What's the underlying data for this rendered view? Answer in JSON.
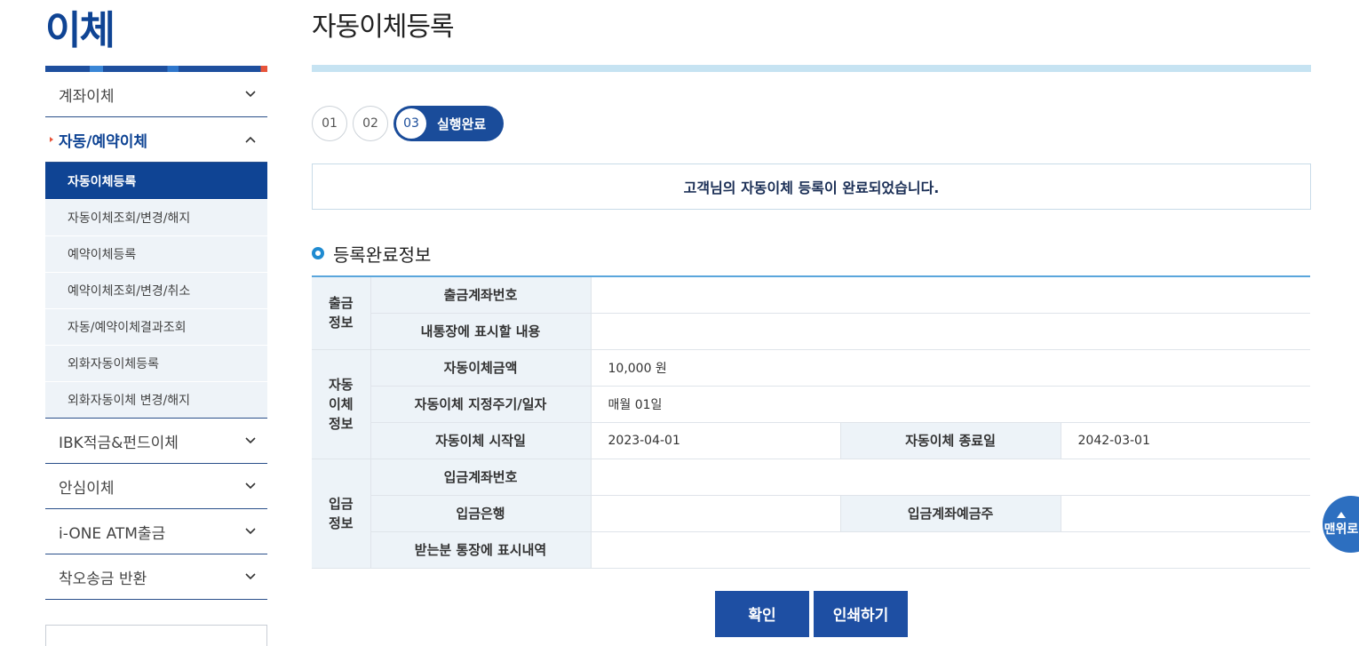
{
  "sidebar": {
    "section_title": "이체",
    "menu": [
      {
        "label": "계좌이체"
      },
      {
        "label": "자동/예약이체"
      },
      {
        "label": "IBK적금&펀드이체"
      },
      {
        "label": "안심이체"
      },
      {
        "label": "i-ONE ATM출금"
      },
      {
        "label": "착오송금 반환"
      }
    ],
    "submenu": [
      {
        "label": "자동이체등록"
      },
      {
        "label": "자동이체조회/변경/해지"
      },
      {
        "label": "예약이체등록"
      },
      {
        "label": "예약이체조회/변경/취소"
      },
      {
        "label": "자동/예약이체결과조회"
      },
      {
        "label": "외화자동이체등록"
      },
      {
        "label": "외화자동이체 변경/해지"
      }
    ]
  },
  "main": {
    "page_title": "자동이체등록",
    "steps": [
      "01",
      "02",
      "03"
    ],
    "active_step_label": "실행완료",
    "notice": "고객님의 자동이체 등록이 완료되었습니다.",
    "section_title": "등록완료정보",
    "table": {
      "groups": {
        "withdraw": "출금\n정보",
        "auto": "자동\n이체\n정보",
        "deposit": "입금\n정보"
      },
      "labels": {
        "withdraw_account": "출금계좌번호",
        "passbook_text": "내통장에 표시할 내용",
        "amount": "자동이체금액",
        "cycle": "자동이체 지정주기/일자",
        "start_date": "자동이체 시작일",
        "end_date": "자동이체 종료일",
        "deposit_account": "입금계좌번호",
        "deposit_bank": "입금은행",
        "deposit_holder": "입금계좌예금주",
        "recipient_text": "받는분 통장에 표시내역"
      },
      "values": {
        "amount": "10,000 원",
        "cycle": "매월 01일",
        "start_date": "2023-04-01",
        "end_date": "2042-03-01"
      }
    },
    "buttons": {
      "confirm": "확인",
      "print": "인쇄하기"
    }
  },
  "floating": {
    "top_label": "맨위로"
  }
}
